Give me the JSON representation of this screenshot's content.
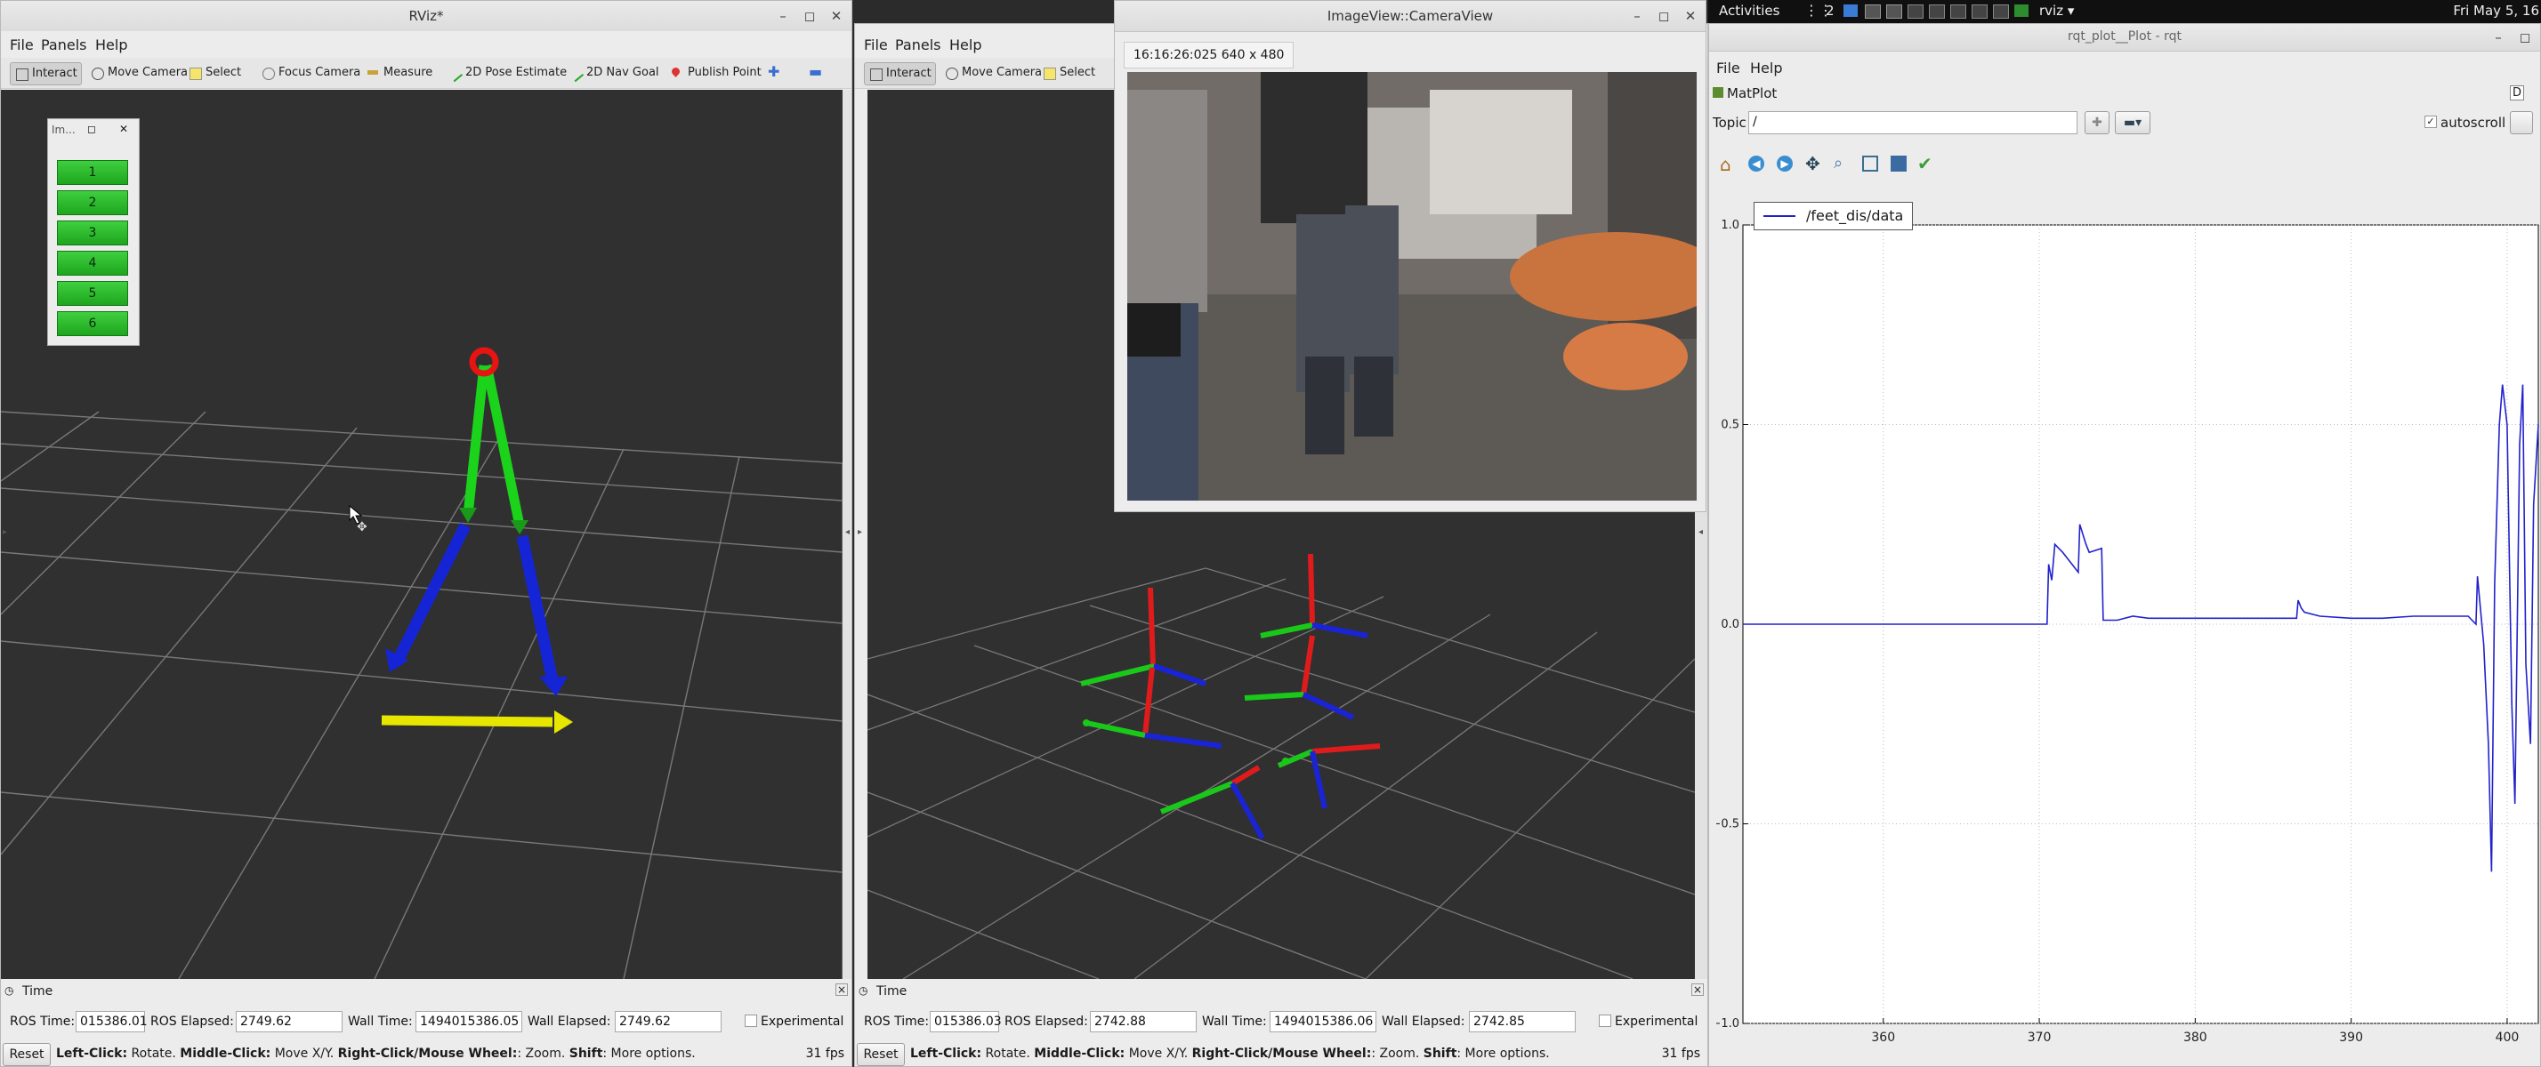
{
  "topbar": {
    "activities": "Activities",
    "workspace": "2",
    "app_label": "rviz ▾",
    "clock": "Fri May 5, 16"
  },
  "rviz1": {
    "title": "RViz*",
    "menu": [
      "File",
      "Panels",
      "Help"
    ],
    "tools": [
      "Interact",
      "Move Camera",
      "Select",
      "Focus Camera",
      "Measure",
      "2D Pose Estimate",
      "2D Nav Goal",
      "Publish Point"
    ],
    "float_panel_title": "Im...",
    "buttons": [
      "1",
      "2",
      "3",
      "4",
      "5",
      "6"
    ],
    "time_panel_title": "Time",
    "ros_time_label": "ROS Time:",
    "ros_time": "015386.01",
    "ros_elapsed_label": "ROS Elapsed:",
    "ros_elapsed": "2749.62",
    "wall_time_label": "Wall Time:",
    "wall_time": "1494015386.05",
    "wall_elapsed_label": "Wall Elapsed:",
    "wall_elapsed": "2749.62",
    "experimental": "Experimental",
    "reset": "Reset",
    "hint_b1": "Left-Click:",
    "hint_t1": " Rotate. ",
    "hint_b2": "Middle-Click:",
    "hint_t2": " Move X/Y. ",
    "hint_b3": "Right-Click/Mouse Wheel:",
    "hint_t3": ": Zoom. ",
    "hint_b4": "Shift",
    "hint_t4": ": More options.",
    "fps": "31 fps"
  },
  "rviz2": {
    "menu": [
      "File",
      "Panels",
      "Help"
    ],
    "tools": [
      "Interact",
      "Move Camera",
      "Select"
    ],
    "time_panel_title": "Time",
    "ros_time_label": "ROS Time:",
    "ros_time": "015386.03",
    "ros_elapsed_label": "ROS Elapsed:",
    "ros_elapsed": "2742.88",
    "wall_time_label": "Wall Time:",
    "wall_time": "1494015386.06",
    "wall_elapsed_label": "Wall Elapsed:",
    "wall_elapsed": "2742.85",
    "experimental": "Experimental",
    "reset": "Reset",
    "hint_b1": "Left-Click:",
    "hint_t1": " Rotate. ",
    "hint_b2": "Middle-Click:",
    "hint_t2": " Move X/Y. ",
    "hint_b3": "Right-Click/Mouse Wheel:",
    "hint_t3": ": Zoom. ",
    "hint_b4": "Shift",
    "hint_t4": ": More options.",
    "fps": "31 fps"
  },
  "imageview": {
    "title": "ImageView::CameraView",
    "info": "16:16:26:025  640 x 480"
  },
  "rqt": {
    "title": "rqt_plot__Plot - rqt",
    "menu": [
      "File",
      "Help"
    ],
    "plugin": "MatPlot",
    "plugin_badge": "D",
    "topic_label": "Topic",
    "topic_value": "/",
    "autoscroll": "autoscroll"
  },
  "chart_data": {
    "type": "line",
    "title": "",
    "xlabel": "",
    "ylabel": "",
    "xlim": [
      351,
      402
    ],
    "ylim": [
      -1.0,
      1.0
    ],
    "xticks": [
      "360",
      "370",
      "380",
      "390",
      "400"
    ],
    "yticks": [
      "1.0",
      "0.5",
      "0.0",
      "−0.5",
      "−1.0"
    ],
    "grid": true,
    "legend": "top-left",
    "series": [
      {
        "name": "/feet_dis/data",
        "color": "#2222cc",
        "x": [
          351,
          369,
          369.1,
          370.5,
          370.6,
          370.8,
          371,
          371.5,
          372.5,
          372.6,
          373,
          373.2,
          374,
          374.1,
          375,
          376,
          377,
          378,
          380,
          382,
          384,
          386.5,
          386.6,
          386.8,
          387,
          388,
          390,
          392,
          394,
          396,
          397.5,
          398,
          398.1,
          398.5,
          398.8,
          399,
          399.2,
          399.5,
          399.7,
          400,
          400.3,
          400.5,
          400.8,
          401,
          401.2,
          401.5,
          401.7,
          402
        ],
        "y": [
          0.0,
          0.0,
          0.0,
          0.0,
          0.15,
          0.11,
          0.2,
          0.18,
          0.13,
          0.25,
          0.2,
          0.18,
          0.19,
          0.01,
          0.01,
          0.02,
          0.015,
          0.015,
          0.015,
          0.015,
          0.015,
          0.015,
          0.06,
          0.04,
          0.03,
          0.02,
          0.015,
          0.015,
          0.02,
          0.02,
          0.02,
          0.0,
          0.12,
          -0.05,
          -0.3,
          -0.62,
          0.1,
          0.5,
          0.6,
          0.5,
          -0.2,
          -0.45,
          0.45,
          0.6,
          -0.1,
          -0.3,
          0.3,
          0.5
        ]
      }
    ]
  }
}
